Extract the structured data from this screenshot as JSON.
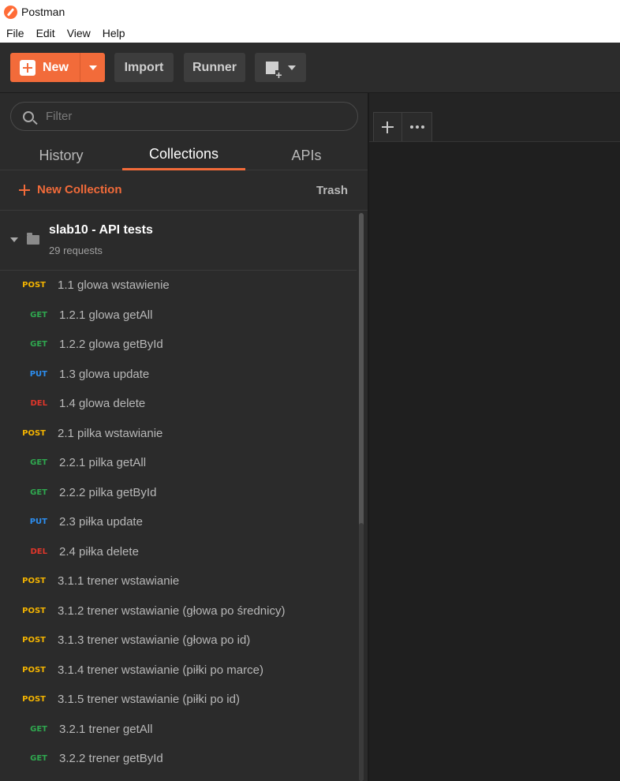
{
  "window": {
    "title": "Postman"
  },
  "menu": [
    "File",
    "Edit",
    "View",
    "Help"
  ],
  "toolbar": {
    "new_label": "New",
    "import_label": "Import",
    "runner_label": "Runner"
  },
  "sidebar": {
    "filter_placeholder": "Filter",
    "tabs": [
      "History",
      "Collections",
      "APIs"
    ],
    "active_tab": "Collections",
    "new_collection_label": "New Collection",
    "trash_label": "Trash",
    "collection": {
      "name": "slab10 - API tests",
      "count": "29 requests"
    },
    "requests": [
      {
        "method": "POST",
        "name": "1.1 glowa wstawienie"
      },
      {
        "method": "GET",
        "name": "1.2.1 glowa getAll"
      },
      {
        "method": "GET",
        "name": "1.2.2 glowa getById"
      },
      {
        "method": "PUT",
        "name": "1.3 glowa update"
      },
      {
        "method": "DEL",
        "name": "1.4 glowa delete"
      },
      {
        "method": "POST",
        "name": "2.1 pilka wstawianie"
      },
      {
        "method": "GET",
        "name": "2.2.1 pilka getAll"
      },
      {
        "method": "GET",
        "name": "2.2.2 pilka getById"
      },
      {
        "method": "PUT",
        "name": "2.3 piłka update"
      },
      {
        "method": "DEL",
        "name": "2.4 piłka delete"
      },
      {
        "method": "POST",
        "name": "3.1.1 trener wstawianie"
      },
      {
        "method": "POST",
        "name": "3.1.2 trener wstawianie (głowa po średnicy)"
      },
      {
        "method": "POST",
        "name": "3.1.3 trener wstawianie (głowa po id)"
      },
      {
        "method": "POST",
        "name": "3.1.4 trener wstawianie (piłki po marce)"
      },
      {
        "method": "POST",
        "name": "3.1.5 trener wstawianie (piłki po id)"
      },
      {
        "method": "GET",
        "name": "3.2.1 trener getAll"
      },
      {
        "method": "GET",
        "name": "3.2.2 trener getById"
      }
    ]
  },
  "colors": {
    "accent": "#f26b3a",
    "POST": "#f4b400",
    "GET": "#2fa84f",
    "PUT": "#2c8ef0",
    "DEL": "#e0362b"
  }
}
